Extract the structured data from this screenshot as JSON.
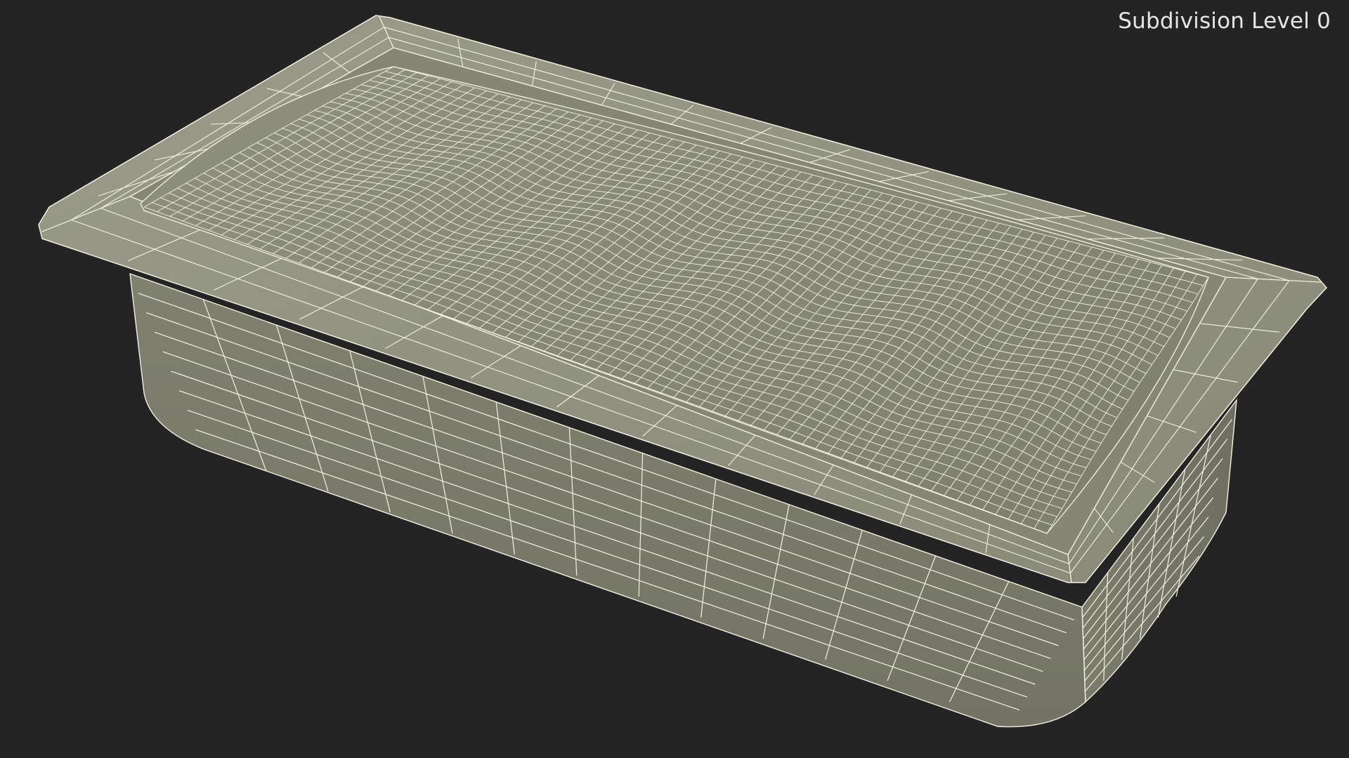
{
  "viewport": {
    "label": "Subdivision Level 0",
    "model_icon": "wireframe-tray-model",
    "colors": {
      "background": "#242424",
      "surface_light": "#8d8e7d",
      "surface_dark": "#6a6b5c",
      "wire": "#f4f2e2",
      "label": "#e6e6e6"
    }
  }
}
